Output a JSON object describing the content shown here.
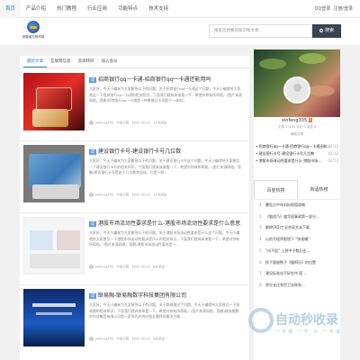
{
  "nav": {
    "items": [
      "首页",
      "产品介绍",
      "热门教程",
      "行业应用",
      "功能特点",
      "技术支持"
    ],
    "active_index": 0
  },
  "toplinks": {
    "qq_login": "QQ登录",
    "register": "注册/登录"
  },
  "logo": {
    "text": "安徽省古桥市场"
  },
  "search": {
    "placeholder": "搜索您想要的知识和文章",
    "button": "搜索"
  },
  "tabs": [
    "最新文章",
    "互联网信息",
    "资源转码",
    "加入会员"
  ],
  "posts": [
    {
      "category": "商",
      "title": "招商银行qq一卡通-招商银行qq一卡通还能用吗",
      "excerpt": "大家好，今天小编来为大家解答以下的问题，关于招商银行qq一卡通这个问题，今天小编就给大家普及一下招商银行qq一卡通的相关知识。下面我们就具体来看一下，希望对你有所帮助。(图片来源网络，侵删)招商银行qq一卡通是一种集借记卡功能于一体的...",
      "author": "xinfeng335",
      "meta_label": "产品介绍",
      "date": "2025-02-12",
      "views": "11次浏览"
    },
    {
      "category": "商",
      "title": "建设银行卡号-建设银行卡号几位数",
      "excerpt": "大家好，今天小编来为大家解答以下的问题，关于建设银行卡号这个问题，今天小编就给大家普及一下建设银行卡号的相关知识，下面我们就具体来看一下，希望对你有所帮助。(图片来源网络，侵删)建设银行卡号是由十几位数字组成，它是一种...",
      "author": "xinfeng335",
      "meta_label": "产品介绍",
      "date": "2025-02-12",
      "views": "11次浏览"
    },
    {
      "category": "商",
      "title": "港股市场流动性要求是什么-港股市场流动性要求是什么意思",
      "excerpt": "大家好，今天小编来为大家解答以下的问题，关于港股市场流动性要求是什么这个问题，今天小编就给大家普及一下港股市场流动性要求是什么的相关知识，下面我们就具体来看一下，希望对你有所帮助。(图片来源网络，侵删)港股市场流动性要求是一...",
      "author": "xinfeng335",
      "meta_label": "产品介绍",
      "date": "2025-02-12",
      "views": "8次浏览"
    },
    {
      "category": "商",
      "title": "联易融-联易融数字科技集团有限公司",
      "excerpt": "大家好，今天小编来为大家解答以下的问题，关于联易融这个问题，今天小编就给大家普及一下联易融的相关知识，下面我们就具体来看一下，希望对你有所帮助。(图片来源网络，侵删)联易融数字科技集团有限公司是一家领先的供应链金融科技解决方案...",
      "author": "xinfeng335",
      "meta_label": "产品介绍",
      "date": "2025-02-12",
      "views": "9次浏览"
    }
  ],
  "profile": {
    "name": "xinfeng335",
    "badge": "V",
    "stats_line1": "文章 17155  评论 0  浏览 6",
    "stats_line2": "最新文章"
  },
  "side_list": [
    {
      "t": "招商银行qq一卡通-招商银行qq一卡通还能...",
      "d": "02/12"
    },
    {
      "t": "建设银行卡号-建设银行卡号几位数",
      "d": "02/12"
    },
    {
      "t": "港股市场流动性要求是什么-港股市场...",
      "d": "02/12"
    }
  ],
  "rank": {
    "tabs": [
      "百度热搜",
      "新酒热榜"
    ],
    "items": [
      "暴乱后中年妈妈保值攻略",
      "《猫战乃》盛华国事政第一部分...",
      "解除(RD)工业合同文本下载",
      "以前写程序报错下 \"快速赚\"",
      "“向不起” 上到中子数后还...",
      "投子要被熊子《猫鸣乐》的位置",
      "建设标准化不好在作 面 ...",
      "原谷长还到世卫去联系..."
    ]
  },
  "watermark": {
    "big": "自动秒收录",
    "small": "一丰诸 一丰 众 一丰诸"
  }
}
